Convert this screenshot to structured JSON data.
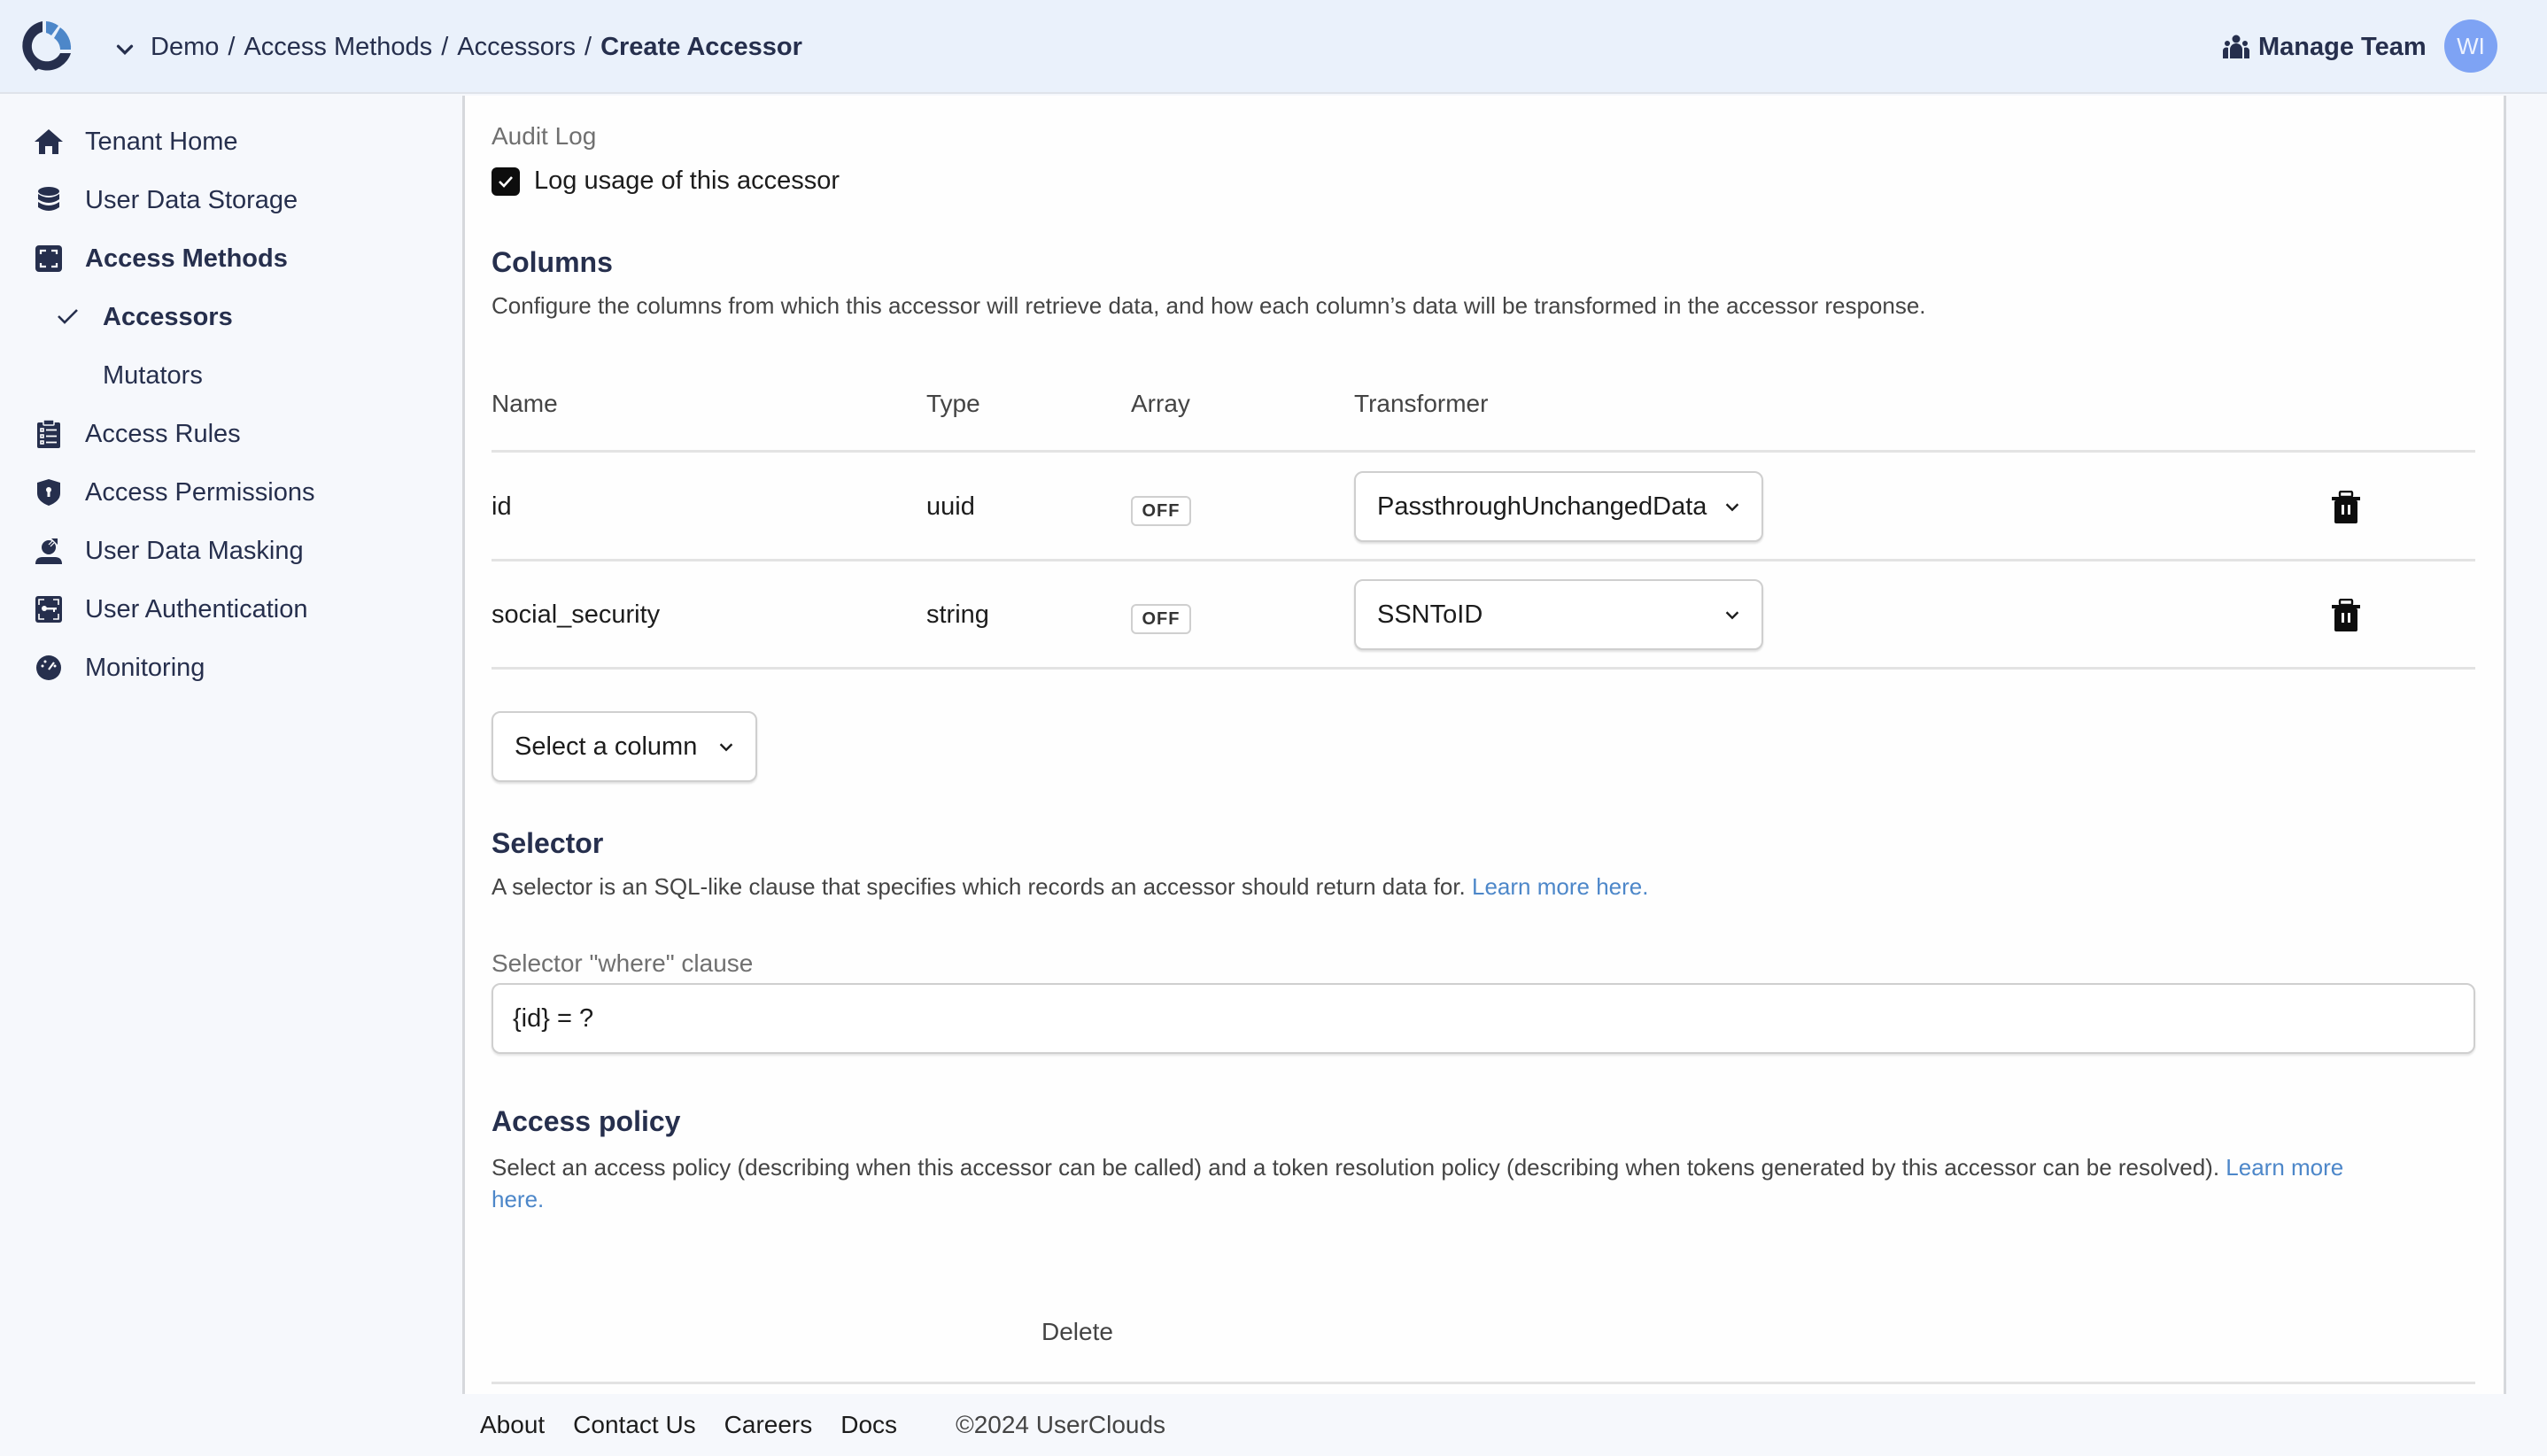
{
  "header": {
    "breadcrumb": [
      "Demo",
      "Access Methods",
      "Accessors",
      "Create Accessor"
    ],
    "separator": "/",
    "manage_team_label": "Manage Team",
    "avatar_initials": "WI"
  },
  "colors": {
    "brand_dark": "#262f4d",
    "brand_blue": "#4d87c9",
    "avatar": "#7ea3f4",
    "link": "#4d87c9"
  },
  "sidebar": {
    "items": [
      {
        "label": "Tenant Home",
        "icon": "home-icon"
      },
      {
        "label": "User Data Storage",
        "icon": "database-icon"
      },
      {
        "label": "Access Methods",
        "icon": "access-methods-icon",
        "active": true,
        "children": [
          {
            "label": "Accessors",
            "icon": "check-icon",
            "active": true
          },
          {
            "label": "Mutators"
          }
        ]
      },
      {
        "label": "Access Rules",
        "icon": "clipboard-list-icon"
      },
      {
        "label": "Access Permissions",
        "icon": "shield-keyhole-icon"
      },
      {
        "label": "User Data Masking",
        "icon": "user-mask-icon"
      },
      {
        "label": "User Authentication",
        "icon": "key-frame-icon"
      },
      {
        "label": "Monitoring",
        "icon": "gauge-icon"
      }
    ]
  },
  "audit_log": {
    "label": "Audit Log",
    "checkbox_label": "Log usage of this accessor",
    "checked": true
  },
  "columns": {
    "title": "Columns",
    "description": "Configure the columns from which this accessor will retrieve data, and how each column’s data will be transformed in the accessor response.",
    "headers": [
      "Name",
      "Type",
      "Array",
      "Transformer"
    ],
    "rows": [
      {
        "name": "id",
        "type": "uuid",
        "array": "OFF",
        "transformer": "PassthroughUnchangedData"
      },
      {
        "name": "social_security",
        "type": "string",
        "array": "OFF",
        "transformer": "SSNToID"
      }
    ],
    "add_column_label": "Select a column"
  },
  "selector": {
    "title": "Selector",
    "description": "A selector is an SQL-like clause that specifies which records an accessor should return data for.",
    "learn_more": "Learn more here.",
    "field_label": "Selector \"where\" clause",
    "field_value": "{id} = ?"
  },
  "access_policy": {
    "title": "Access policy",
    "description": "Select an access policy (describing when this accessor can be called) and a token resolution policy (describing when tokens generated by this accessor can be resolved).",
    "learn_more_1": "Learn more",
    "learn_more_2": "here.",
    "delete_label": "Delete"
  },
  "footer": {
    "links": [
      "About",
      "Contact Us",
      "Careers",
      "Docs"
    ],
    "copyright": "©2024 UserClouds"
  }
}
